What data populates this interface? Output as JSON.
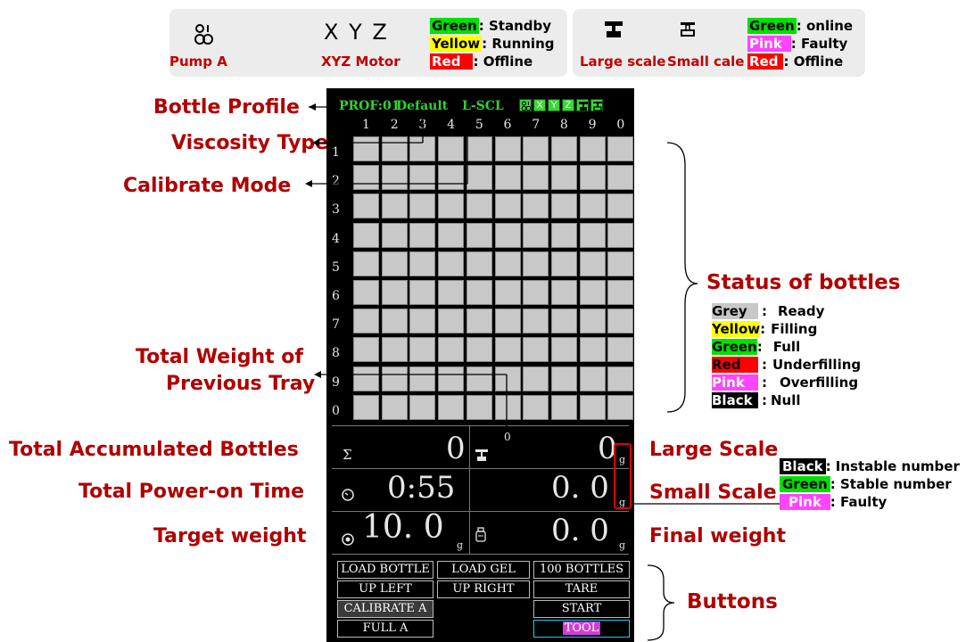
{
  "legend_left": {
    "pump_label": "Pump A",
    "xyz_letters": "X Y Z",
    "xyz_label": "XYZ Motor",
    "keys": [
      {
        "color_name": "Green",
        "meaning": "Standby",
        "color": "#00e000"
      },
      {
        "color_name": "Yellow",
        "meaning": "Running",
        "color": "#ffff00"
      },
      {
        "color_name": "Red",
        "meaning": "Offline",
        "color": "#ff0000"
      }
    ]
  },
  "legend_right": {
    "large_scale_label": "Large scale",
    "small_scale_label": "Small cale",
    "keys": [
      {
        "color_name": "Green",
        "meaning": "online",
        "color": "#00e000"
      },
      {
        "color_name": "Pink",
        "meaning": "Faulty",
        "color": "#ff44ff"
      },
      {
        "color_name": "Red",
        "meaning": "Offline",
        "color": "#ff0000"
      }
    ]
  },
  "annotations": {
    "bottle_profile": "Bottle Profile",
    "viscosity_type": "Viscosity Type",
    "calibrate_mode": "Calibrate Mode",
    "total_weight_prev_1": "Total Weight of",
    "total_weight_prev_2": "Previous Tray",
    "total_accumulated": "Total Accumulated Bottles",
    "total_power_on": "Total Power-on Time",
    "target_weight": "Target weight",
    "large_scale": "Large Scale",
    "small_scale": "Small Scale",
    "final_weight": "Final weight",
    "status_of_bottles": "Status of bottles",
    "buttons": "Buttons"
  },
  "status_keys": [
    {
      "color_name": "Grey",
      "sep": ":",
      "meaning": "Ready",
      "color": "#c8c8c8",
      "text": "#000"
    },
    {
      "color_name": "Yellow",
      "sep": ":",
      "meaning": "Filling",
      "color": "#ffff00",
      "text": "#000"
    },
    {
      "color_name": "Green",
      "sep": ":",
      "meaning": "Full",
      "color": "#00e000",
      "text": "#000"
    },
    {
      "color_name": "Red",
      "sep": ":",
      "meaning": "Underfilling",
      "color": "#ff0000",
      "text": "#000"
    },
    {
      "color_name": "Pink",
      "sep": ":",
      "meaning": "Overfilling",
      "color": "#ff44ff",
      "text": "#000"
    },
    {
      "color_name": "Black",
      "sep": ":",
      "meaning": "Null",
      "color": "#000000",
      "text": "#ffffff"
    }
  ],
  "scale_keys": [
    {
      "color_name": "Black",
      "meaning": ": Instable number",
      "color": "#000000",
      "text": "#ffffff"
    },
    {
      "color_name": "Green",
      "meaning": ": Stable number",
      "color": "#00e000",
      "text": "#000"
    },
    {
      "color_name": "Pink",
      "meaning": ": Faulty",
      "color": "#ff44ff",
      "text": "#ffffff"
    }
  ],
  "screen": {
    "profile": "PROF:01",
    "viscosity": "Default",
    "calibrate": "L-SCL",
    "column_numbers": [
      "1",
      "2",
      "3",
      "4",
      "5",
      "6",
      "7",
      "8",
      "9",
      "0"
    ],
    "row_numbers": [
      "1",
      "2",
      "3",
      "4",
      "5",
      "6",
      "7",
      "8",
      "9",
      "0"
    ],
    "prev_tray_weight": "0",
    "total_bottles": "0",
    "large_scale_value": "0",
    "large_scale_unit": "g",
    "power_on_time": "0:55",
    "small_scale_value": "0. 0",
    "small_scale_unit": "g",
    "target_weight_value": "10. 0",
    "target_unit": "g",
    "final_weight_value": "0. 0",
    "final_unit": "g",
    "buttons": {
      "load_bottle": "LOAD BOTTLE",
      "load_gel": "LOAD GEL",
      "hundred_bottles": "100 BOTTLES",
      "up_left": "UP LEFT",
      "up_right": "UP RIGHT",
      "tare": "TARE",
      "calibrate_a": "CALIBRATE A",
      "start": "START",
      "full_a": "FULL A",
      "tool": "TOOL"
    }
  }
}
